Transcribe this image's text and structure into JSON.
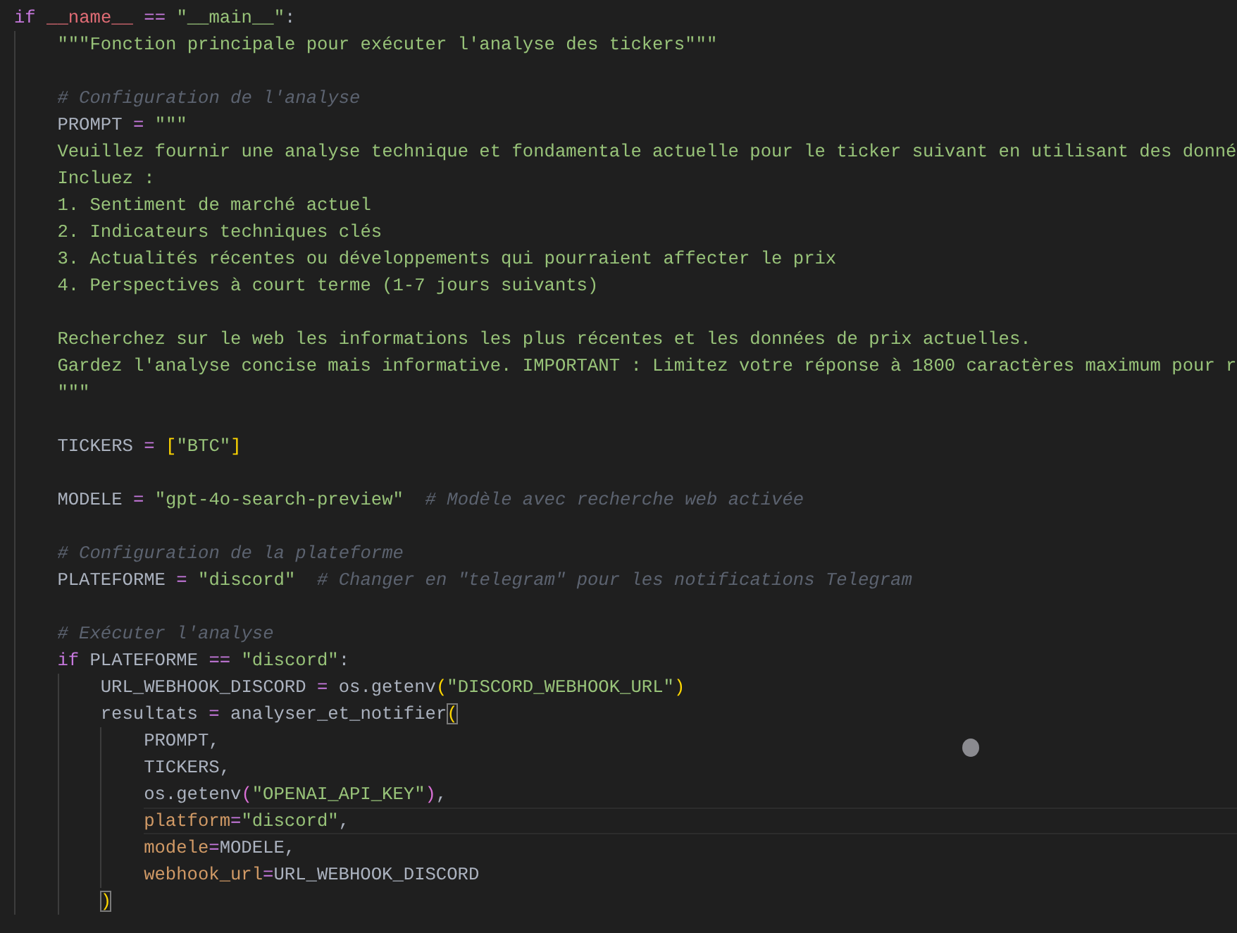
{
  "editor": {
    "lines": [
      {
        "kind": "code",
        "current": false,
        "tokens": [
          {
            "kind": "kw",
            "text": "if "
          },
          {
            "kind": "dunder",
            "text": "__name__"
          },
          {
            "kind": "op",
            "text": " == "
          },
          {
            "kind": "str",
            "text": "\"__main__\""
          },
          {
            "kind": "plain",
            "text": ":"
          }
        ],
        "children": [
          {
            "kind": "code",
            "current": false,
            "tokens": [
              {
                "kind": "str",
                "text": "\"\"\"Fonction principale pour exécuter l'analyse des tickers\"\"\""
              }
            ]
          },
          {
            "kind": "blank",
            "current": false
          },
          {
            "kind": "code",
            "current": false,
            "tokens": [
              {
                "kind": "comment",
                "text": "# Configuration de l'analyse"
              }
            ]
          },
          {
            "kind": "code",
            "current": false,
            "tokens": [
              {
                "kind": "plain",
                "text": "PROMPT"
              },
              {
                "kind": "op",
                "text": " = "
              },
              {
                "kind": "str",
                "text": "\"\"\""
              }
            ]
          },
          {
            "kind": "code",
            "current": false,
            "tokens": [
              {
                "kind": "str",
                "text": "Veuillez fournir une analyse technique et fondamentale actuelle pour le ticker suivant en utilisant des donné"
              }
            ]
          },
          {
            "kind": "code",
            "current": false,
            "tokens": [
              {
                "kind": "str",
                "text": "Incluez :"
              }
            ]
          },
          {
            "kind": "code",
            "current": false,
            "tokens": [
              {
                "kind": "str",
                "text": "1. Sentiment de marché actuel"
              }
            ]
          },
          {
            "kind": "code",
            "current": false,
            "tokens": [
              {
                "kind": "str",
                "text": "2. Indicateurs techniques clés"
              }
            ]
          },
          {
            "kind": "code",
            "current": false,
            "tokens": [
              {
                "kind": "str",
                "text": "3. Actualités récentes ou développements qui pourraient affecter le prix"
              }
            ]
          },
          {
            "kind": "code",
            "current": false,
            "tokens": [
              {
                "kind": "str",
                "text": "4. Perspectives à court terme (1-7 jours suivants)"
              }
            ]
          },
          {
            "kind": "blank",
            "current": false
          },
          {
            "kind": "code",
            "current": false,
            "tokens": [
              {
                "kind": "str",
                "text": "Recherchez sur le web les informations les plus récentes et les données de prix actuelles."
              }
            ]
          },
          {
            "kind": "code",
            "current": false,
            "tokens": [
              {
                "kind": "str",
                "text": "Gardez l'analyse concise mais informative. IMPORTANT : Limitez votre réponse à 1800 caractères maximum pour r"
              }
            ]
          },
          {
            "kind": "code",
            "current": false,
            "tokens": [
              {
                "kind": "str",
                "text": "\"\"\""
              }
            ]
          },
          {
            "kind": "blank",
            "current": false
          },
          {
            "kind": "code",
            "current": false,
            "tokens": [
              {
                "kind": "plain",
                "text": "TICKERS"
              },
              {
                "kind": "op",
                "text": " = "
              },
              {
                "kind": "bracket1",
                "text": "["
              },
              {
                "kind": "str",
                "text": "\"BTC\""
              },
              {
                "kind": "bracket1",
                "text": "]"
              }
            ]
          },
          {
            "kind": "blank",
            "current": false
          },
          {
            "kind": "code",
            "current": false,
            "tokens": [
              {
                "kind": "plain",
                "text": "MODELE"
              },
              {
                "kind": "op",
                "text": " = "
              },
              {
                "kind": "str",
                "text": "\"gpt-4o-search-preview\""
              },
              {
                "kind": "comment",
                "text": "  # Modèle avec recherche web activée"
              }
            ]
          },
          {
            "kind": "blank",
            "current": false
          },
          {
            "kind": "code",
            "current": false,
            "tokens": [
              {
                "kind": "comment",
                "text": "# Configuration de la plateforme"
              }
            ]
          },
          {
            "kind": "code",
            "current": false,
            "tokens": [
              {
                "kind": "plain",
                "text": "PLATEFORME"
              },
              {
                "kind": "op",
                "text": " = "
              },
              {
                "kind": "str",
                "text": "\"discord\""
              },
              {
                "kind": "comment",
                "text": "  # Changer en \"telegram\" pour les notifications Telegram"
              }
            ]
          },
          {
            "kind": "blank",
            "current": false
          },
          {
            "kind": "code",
            "current": false,
            "tokens": [
              {
                "kind": "comment",
                "text": "# Exécuter l'analyse"
              }
            ]
          },
          {
            "kind": "code",
            "current": false,
            "tokens": [
              {
                "kind": "kw",
                "text": "if "
              },
              {
                "kind": "plain",
                "text": "PLATEFORME"
              },
              {
                "kind": "op",
                "text": " == "
              },
              {
                "kind": "str",
                "text": "\"discord\""
              },
              {
                "kind": "plain",
                "text": ":"
              }
            ],
            "children": [
              {
                "kind": "code",
                "current": false,
                "tokens": [
                  {
                    "kind": "plain",
                    "text": "URL_WEBHOOK_DISCORD"
                  },
                  {
                    "kind": "op",
                    "text": " = "
                  },
                  {
                    "kind": "plain",
                    "text": "os.getenv"
                  },
                  {
                    "kind": "bracket1",
                    "text": "("
                  },
                  {
                    "kind": "str",
                    "text": "\"DISCORD_WEBHOOK_URL\""
                  },
                  {
                    "kind": "bracket1",
                    "text": ")"
                  }
                ]
              },
              {
                "kind": "code",
                "current": false,
                "tokens": [
                  {
                    "kind": "plain",
                    "text": "resultats"
                  },
                  {
                    "kind": "op",
                    "text": " = "
                  },
                  {
                    "kind": "plain",
                    "text": "analyser_et_notifier"
                  },
                  {
                    "kind": "match",
                    "text": "("
                  }
                ],
                "children": [
                  {
                    "kind": "code",
                    "current": false,
                    "tokens": [
                      {
                        "kind": "plain",
                        "text": "PROMPT,"
                      }
                    ]
                  },
                  {
                    "kind": "code",
                    "current": false,
                    "tokens": [
                      {
                        "kind": "plain",
                        "text": "TICKERS,"
                      }
                    ]
                  },
                  {
                    "kind": "code",
                    "current": false,
                    "tokens": [
                      {
                        "kind": "plain",
                        "text": "os.getenv"
                      },
                      {
                        "kind": "bracket2",
                        "text": "("
                      },
                      {
                        "kind": "str",
                        "text": "\"OPENAI_API_KEY\""
                      },
                      {
                        "kind": "bracket2",
                        "text": ")"
                      },
                      {
                        "kind": "plain",
                        "text": ","
                      }
                    ]
                  },
                  {
                    "kind": "code",
                    "current": true,
                    "tokens": [
                      {
                        "kind": "param",
                        "text": "platform"
                      },
                      {
                        "kind": "op",
                        "text": "="
                      },
                      {
                        "kind": "str",
                        "text": "\"discord\""
                      },
                      {
                        "kind": "plain",
                        "text": ","
                      }
                    ]
                  },
                  {
                    "kind": "code",
                    "current": false,
                    "tokens": [
                      {
                        "kind": "param",
                        "text": "modele"
                      },
                      {
                        "kind": "op",
                        "text": "="
                      },
                      {
                        "kind": "plain",
                        "text": "MODELE,"
                      }
                    ]
                  },
                  {
                    "kind": "code",
                    "current": false,
                    "tokens": [
                      {
                        "kind": "param",
                        "text": "webhook_url"
                      },
                      {
                        "kind": "op",
                        "text": "="
                      },
                      {
                        "kind": "plain",
                        "text": "URL_WEBHOOK_DISCORD"
                      }
                    ]
                  }
                ]
              },
              {
                "kind": "code",
                "current": false,
                "tokens": [
                  {
                    "kind": "match",
                    "text": ")"
                  }
                ]
              }
            ]
          }
        ]
      }
    ]
  }
}
